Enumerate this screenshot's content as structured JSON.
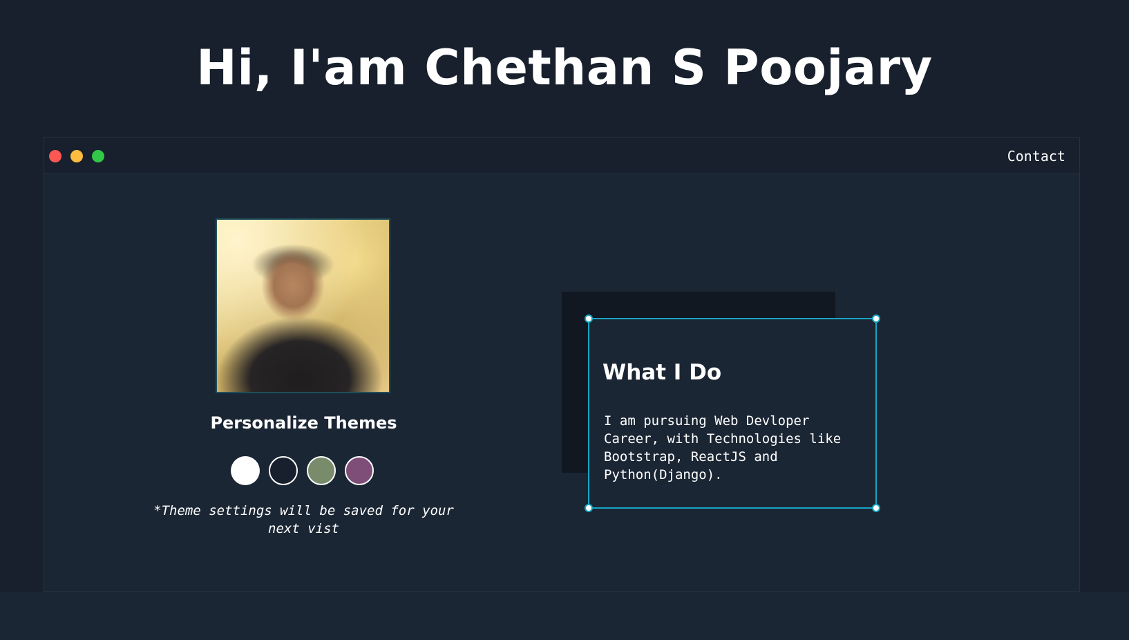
{
  "hero": {
    "title": "Hi, I'am Chethan S Poojary"
  },
  "window": {
    "controls": [
      "close-icon",
      "minimize-icon",
      "maximize-icon"
    ],
    "nav": {
      "contact_label": "Contact"
    }
  },
  "profile": {
    "photo_alt": "Chethan S Poojary"
  },
  "themes": {
    "heading": "Personalize Themes",
    "swatches": [
      {
        "name": "light",
        "color": "#ffffff"
      },
      {
        "name": "dark",
        "color": "#17202c"
      },
      {
        "name": "green",
        "color": "#788c6c"
      },
      {
        "name": "purple",
        "color": "#7e4d78"
      }
    ],
    "note": "*Theme settings will be saved for your next vist"
  },
  "about": {
    "title": "What I Do",
    "body": "I am pursuing Web Devloper Career, with Technologies like Bootstrap, ReactJS and Python(Django)."
  },
  "colors": {
    "background": "#17202c",
    "panel": "#1b2634",
    "accent": "#16a6c4"
  }
}
